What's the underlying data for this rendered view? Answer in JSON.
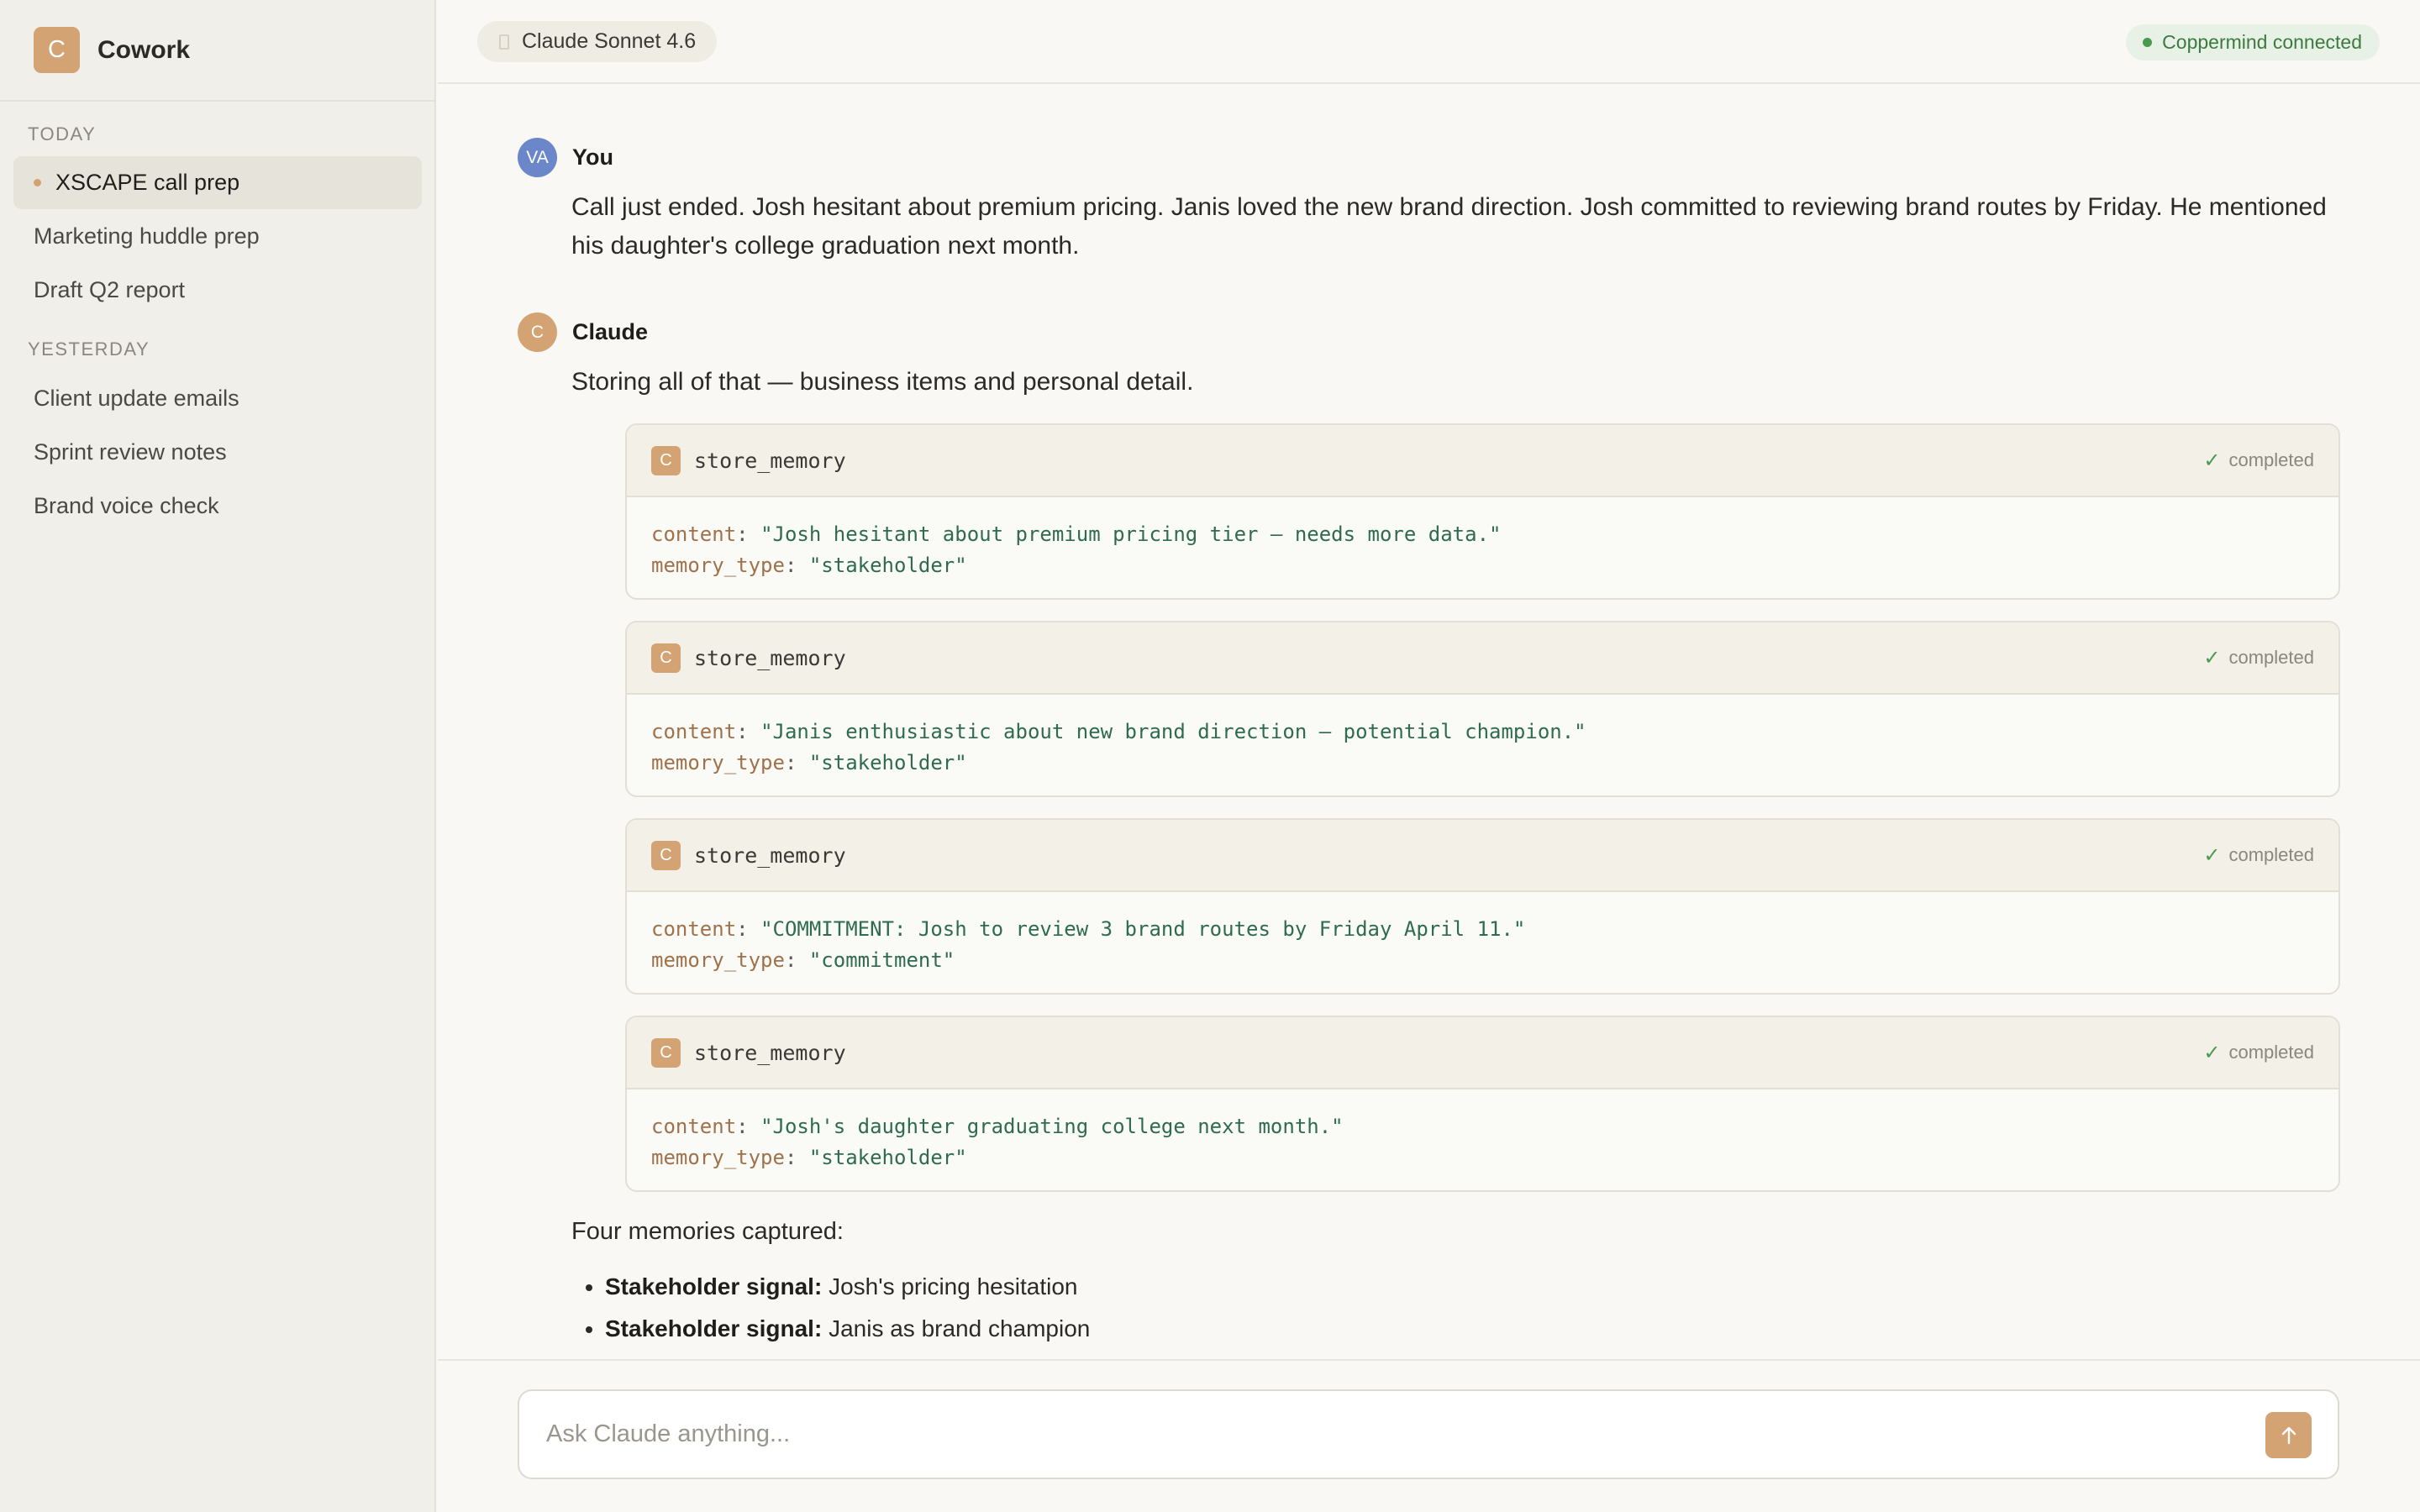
{
  "app": {
    "logo_letter": "C",
    "name": "Cowork"
  },
  "sidebar": {
    "sections": [
      {
        "label": "TODAY",
        "items": [
          "XSCAPE call prep",
          "Marketing huddle prep",
          "Draft Q2 report"
        ]
      },
      {
        "label": "YESTERDAY",
        "items": [
          "Client update emails",
          "Sprint review notes",
          "Brand voice check"
        ]
      }
    ],
    "active_item": "XSCAPE call prep"
  },
  "header": {
    "model": "Claude Sonnet 4.6",
    "status": "Coppermind connected"
  },
  "messages": {
    "user": {
      "avatar": "VA",
      "author": "You",
      "text": "Call just ended. Josh hesitant about premium pricing. Janis loved the new brand direction. Josh committed to reviewing brand routes by Friday. He mentioned his daughter's college graduation next month."
    },
    "assistant": {
      "avatar": "C",
      "author": "Claude",
      "intro": "Storing all of that — business items and personal detail.",
      "tool_calls": [
        {
          "icon": "C",
          "name": "store_memory",
          "status": "completed",
          "content_key": "content",
          "content": "\"Josh hesitant about premium pricing tier — needs more data.\"",
          "type_key": "memory_type",
          "memory_type": "\"stakeholder\""
        },
        {
          "icon": "C",
          "name": "store_memory",
          "status": "completed",
          "content_key": "content",
          "content": "\"Janis enthusiastic about new brand direction — potential champion.\"",
          "type_key": "memory_type",
          "memory_type": "\"stakeholder\""
        },
        {
          "icon": "C",
          "name": "store_memory",
          "status": "completed",
          "content_key": "content",
          "content": "\"COMMITMENT: Josh to review 3 brand routes by Friday April 11.\"",
          "type_key": "memory_type",
          "memory_type": "\"commitment\""
        },
        {
          "icon": "C",
          "name": "store_memory",
          "status": "completed",
          "content_key": "content",
          "content": "\"Josh's daughter graduating college next month.\"",
          "type_key": "memory_type",
          "memory_type": "\"stakeholder\""
        }
      ],
      "summary": "Four memories captured:",
      "bullets": [
        {
          "label": "Stakeholder signal:",
          "text": "Josh's pricing hesitation"
        },
        {
          "label": "Stakeholder signal:",
          "text": "Janis as brand champion"
        }
      ]
    }
  },
  "composer": {
    "placeholder": "Ask Claude anything...",
    "send_icon": "arrow-up-icon"
  },
  "colors": {
    "accent": "#d4a373",
    "user_avatar": "#6b86c9",
    "success": "#4a9a4f"
  }
}
